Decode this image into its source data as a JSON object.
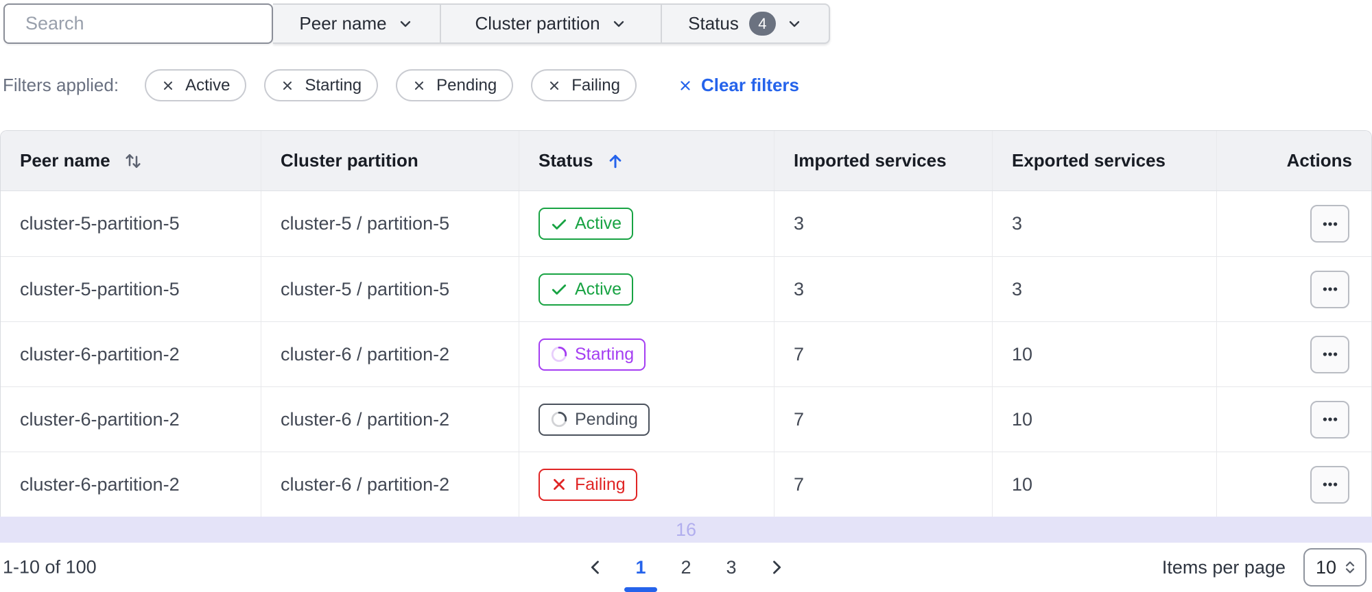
{
  "colors": {
    "accent": "#2563eb",
    "green": "#18a343",
    "purple": "#a43df2",
    "red": "#e02424",
    "pending": "#4a515c",
    "band-bg": "#e4e3f8",
    "band-text": "#b1aeee"
  },
  "toolbar": {
    "search_placeholder": "Search",
    "dropdowns": [
      {
        "label": "Peer name"
      },
      {
        "label": "Cluster partition"
      },
      {
        "label": "Status",
        "badge": "4"
      }
    ]
  },
  "filters": {
    "label": "Filters applied:",
    "chips": [
      "Active",
      "Starting",
      "Pending",
      "Failing"
    ],
    "clear_label": "Clear filters"
  },
  "table": {
    "columns": [
      {
        "label": "Peer name",
        "sort": "both"
      },
      {
        "label": "Cluster partition",
        "sort": "none"
      },
      {
        "label": "Status",
        "sort": "asc"
      },
      {
        "label": "Imported services",
        "sort": "none"
      },
      {
        "label": "Exported services",
        "sort": "none"
      },
      {
        "label": "Actions",
        "sort": "none"
      }
    ],
    "rows": [
      {
        "peer_name": "cluster-5-partition-5",
        "cluster_partition": "cluster-5 / partition-5",
        "status": "Active",
        "imported": "3",
        "exported": "3"
      },
      {
        "peer_name": "cluster-5-partition-5",
        "cluster_partition": "cluster-5 / partition-5",
        "status": "Active",
        "imported": "3",
        "exported": "3"
      },
      {
        "peer_name": "cluster-6-partition-2",
        "cluster_partition": "cluster-6 / partition-2",
        "status": "Starting",
        "imported": "7",
        "exported": "10"
      },
      {
        "peer_name": "cluster-6-partition-2",
        "cluster_partition": "cluster-6 / partition-2",
        "status": "Pending",
        "imported": "7",
        "exported": "10"
      },
      {
        "peer_name": "cluster-6-partition-2",
        "cluster_partition": "cluster-6 / partition-2",
        "status": "Failing",
        "imported": "7",
        "exported": "10"
      }
    ]
  },
  "scroll_indicator": {
    "value": "16"
  },
  "pagination": {
    "range_label": "1-10 of 100",
    "pages": [
      "1",
      "2",
      "3"
    ],
    "current_page": "1",
    "items_per_page_label": "Items per page",
    "items_per_page_value": "10"
  }
}
